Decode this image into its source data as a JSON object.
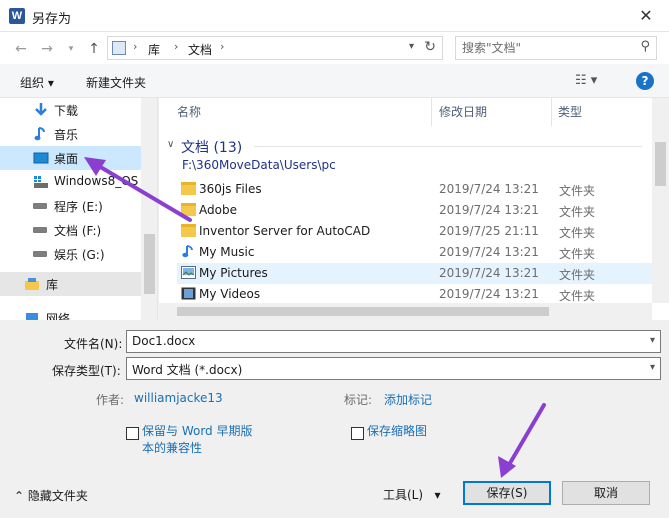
{
  "window": {
    "title": "另存为",
    "close": "✕",
    "app_logo": "W"
  },
  "nav": {
    "breadcrumb": [
      "库",
      "文档"
    ],
    "search_placeholder": "搜索\"文档\""
  },
  "toolbar": {
    "organize": "组织 ▾",
    "new_folder": "新建文件夹"
  },
  "sidebar": {
    "items": [
      {
        "label": "下载",
        "icon": "download-icon"
      },
      {
        "label": "音乐",
        "icon": "music-note-icon"
      },
      {
        "label": "桌面",
        "icon": "desktop-icon",
        "selected": true
      },
      {
        "label": "Windows8_OS",
        "icon": "windows-drive-icon"
      },
      {
        "label": "程序 (E:)",
        "icon": "drive-icon"
      },
      {
        "label": "文档 (F:)",
        "icon": "drive-icon"
      },
      {
        "label": "娱乐 (G:)",
        "icon": "drive-icon"
      },
      {
        "label": "库",
        "icon": "library-icon",
        "section": true
      },
      {
        "label": "网络",
        "icon": "network-icon"
      }
    ]
  },
  "columns": {
    "name": "名称",
    "date": "修改日期",
    "type": "类型"
  },
  "group": {
    "title": "文档 (13)",
    "path": "F:\\360MoveData\\Users\\pc"
  },
  "files": [
    {
      "name": "360js Files",
      "date": "2019/7/24 13:21",
      "type": "文件夹",
      "icon": "folder-icon"
    },
    {
      "name": "Adobe",
      "date": "2019/7/24 13:21",
      "type": "文件夹",
      "icon": "folder-icon"
    },
    {
      "name": "Inventor Server for AutoCAD",
      "date": "2019/7/25 21:11",
      "type": "文件夹",
      "icon": "folder-icon"
    },
    {
      "name": "My Music",
      "date": "2019/7/24 13:21",
      "type": "文件夹",
      "icon": "music-folder-icon"
    },
    {
      "name": "My Pictures",
      "date": "2019/7/24 13:21",
      "type": "文件夹",
      "icon": "pictures-folder-icon",
      "highlighted": true
    },
    {
      "name": "My Videos",
      "date": "2019/7/24 13:21",
      "type": "文件夹",
      "icon": "videos-folder-icon"
    }
  ],
  "form": {
    "filename_label": "文件名(N):",
    "filename_value": "Doc1.docx",
    "filetype_label": "保存类型(T):",
    "filetype_value": "Word 文档 (*.docx)",
    "author_label": "作者:",
    "author_value": "williamjacke13",
    "tags_label": "标记:",
    "tags_value": "添加标记",
    "compat_line1": "保留与 Word 早期版",
    "compat_line2": "本的兼容性",
    "thumbnail_label": "保存缩略图"
  },
  "footer": {
    "hide_folders": "隐藏文件夹",
    "tools": "工具(L)",
    "save": "保存(S)",
    "cancel": "取消"
  },
  "colors": {
    "accent": "#0078d7",
    "selection": "#cce8ff",
    "link": "#1a6fb5",
    "annotation_arrow": "#8b3fd1"
  }
}
